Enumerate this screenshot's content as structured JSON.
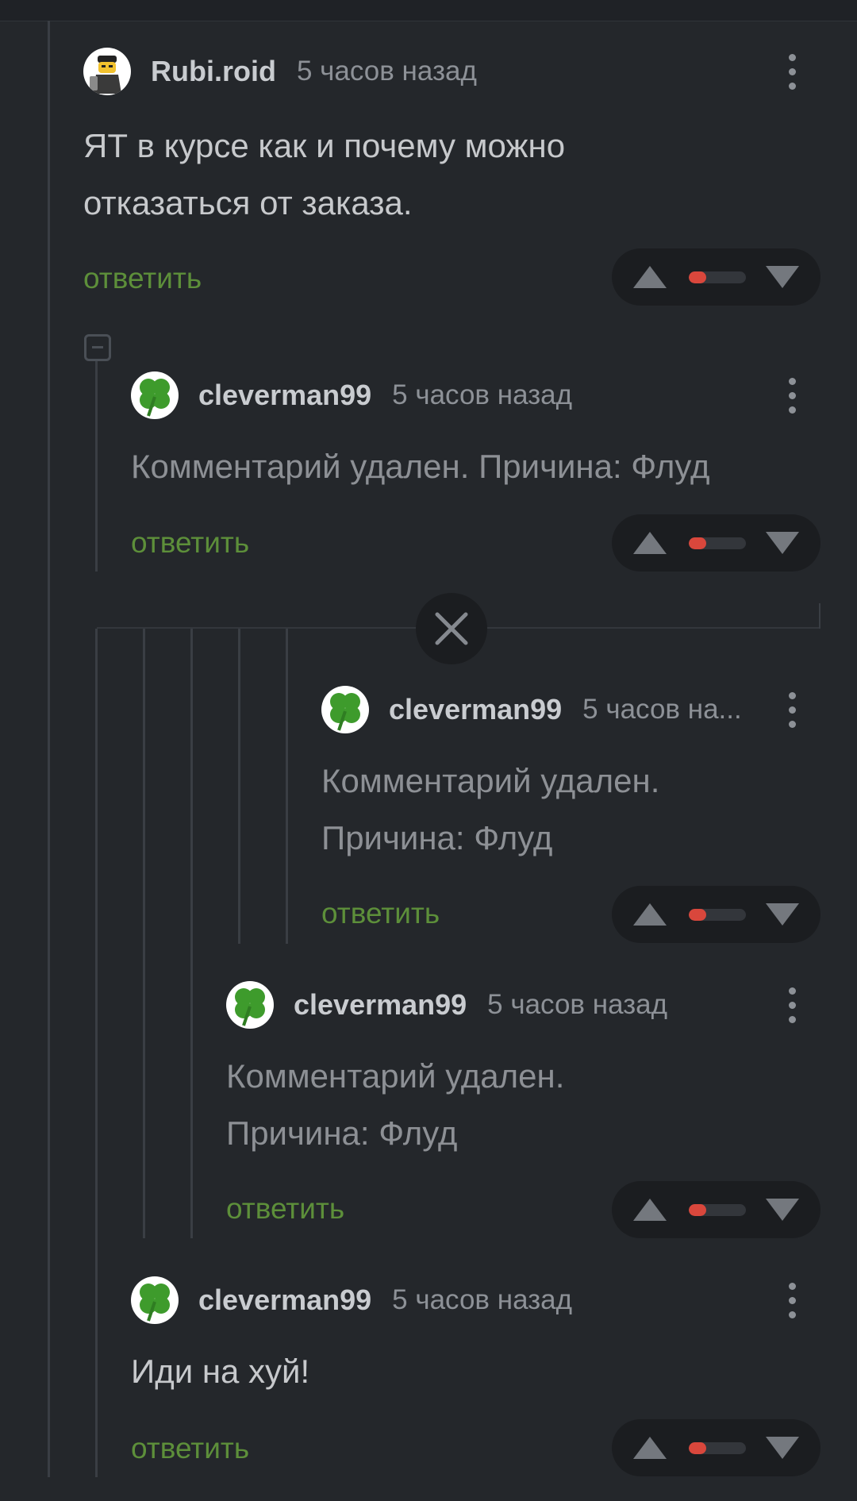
{
  "comments": [
    {
      "username": "Rubi.roid",
      "time": "5 часов назад",
      "body": "ЯТ в курсе как и почему можно отказаться от заказа.",
      "reply": "ответить",
      "avatar": "lego-figure-avatar"
    },
    {
      "username": "cleverman99",
      "time": "5 часов назад",
      "body": "Комментарий удален. Причина: Флуд",
      "reply": "ответить",
      "avatar": "clover-avatar"
    },
    {
      "username": "cleverman99",
      "time": "5 часов на...",
      "body": "Комментарий удален. Причина: Флуд",
      "reply": "ответить",
      "avatar": "clover-avatar"
    },
    {
      "username": "cleverman99",
      "time": "5 часов назад",
      "body": "Комментарий удален. Причина: Флуд",
      "reply": "ответить",
      "avatar": "clover-avatar"
    },
    {
      "username": "cleverman99",
      "time": "5 часов назад",
      "body": "Иди на хуй!",
      "reply": "ответить",
      "avatar": "clover-avatar"
    }
  ],
  "colors": {
    "background": "#24272b",
    "reply_link": "#5d8f3a",
    "downvote_bar": "#d9473c",
    "vote_pill": "#1b1d20"
  },
  "icons": [
    "more-vertical-icon",
    "upvote-arrow-icon",
    "downvote-arrow-icon",
    "close-icon",
    "collapse-icon"
  ],
  "rating_bar_fill": 0.3
}
